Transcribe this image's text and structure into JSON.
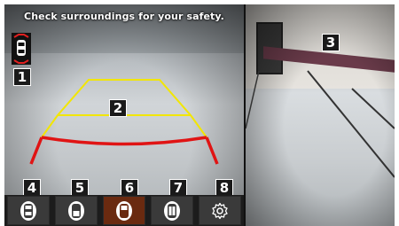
{
  "warning_text": "Check surroundings for your safety.",
  "callouts": {
    "c1": "1",
    "c2": "2",
    "c3": "3",
    "c4": "4",
    "c5": "5",
    "c6": "6",
    "c7": "7",
    "c8": "8"
  },
  "toolbar": {
    "buttons": [
      {
        "icon": "rear-view-icon",
        "active": false
      },
      {
        "icon": "rear-top-view-icon",
        "active": false
      },
      {
        "icon": "front-view-icon",
        "active": true
      },
      {
        "icon": "side-view-icon",
        "active": false
      },
      {
        "icon": "settings-gear-icon",
        "active": false
      }
    ]
  },
  "colors": {
    "guide_yellow": "#f2e600",
    "guide_red": "#e01414",
    "active_button": "#6a2a10",
    "toolbar_bg": "#1c1c1c"
  }
}
